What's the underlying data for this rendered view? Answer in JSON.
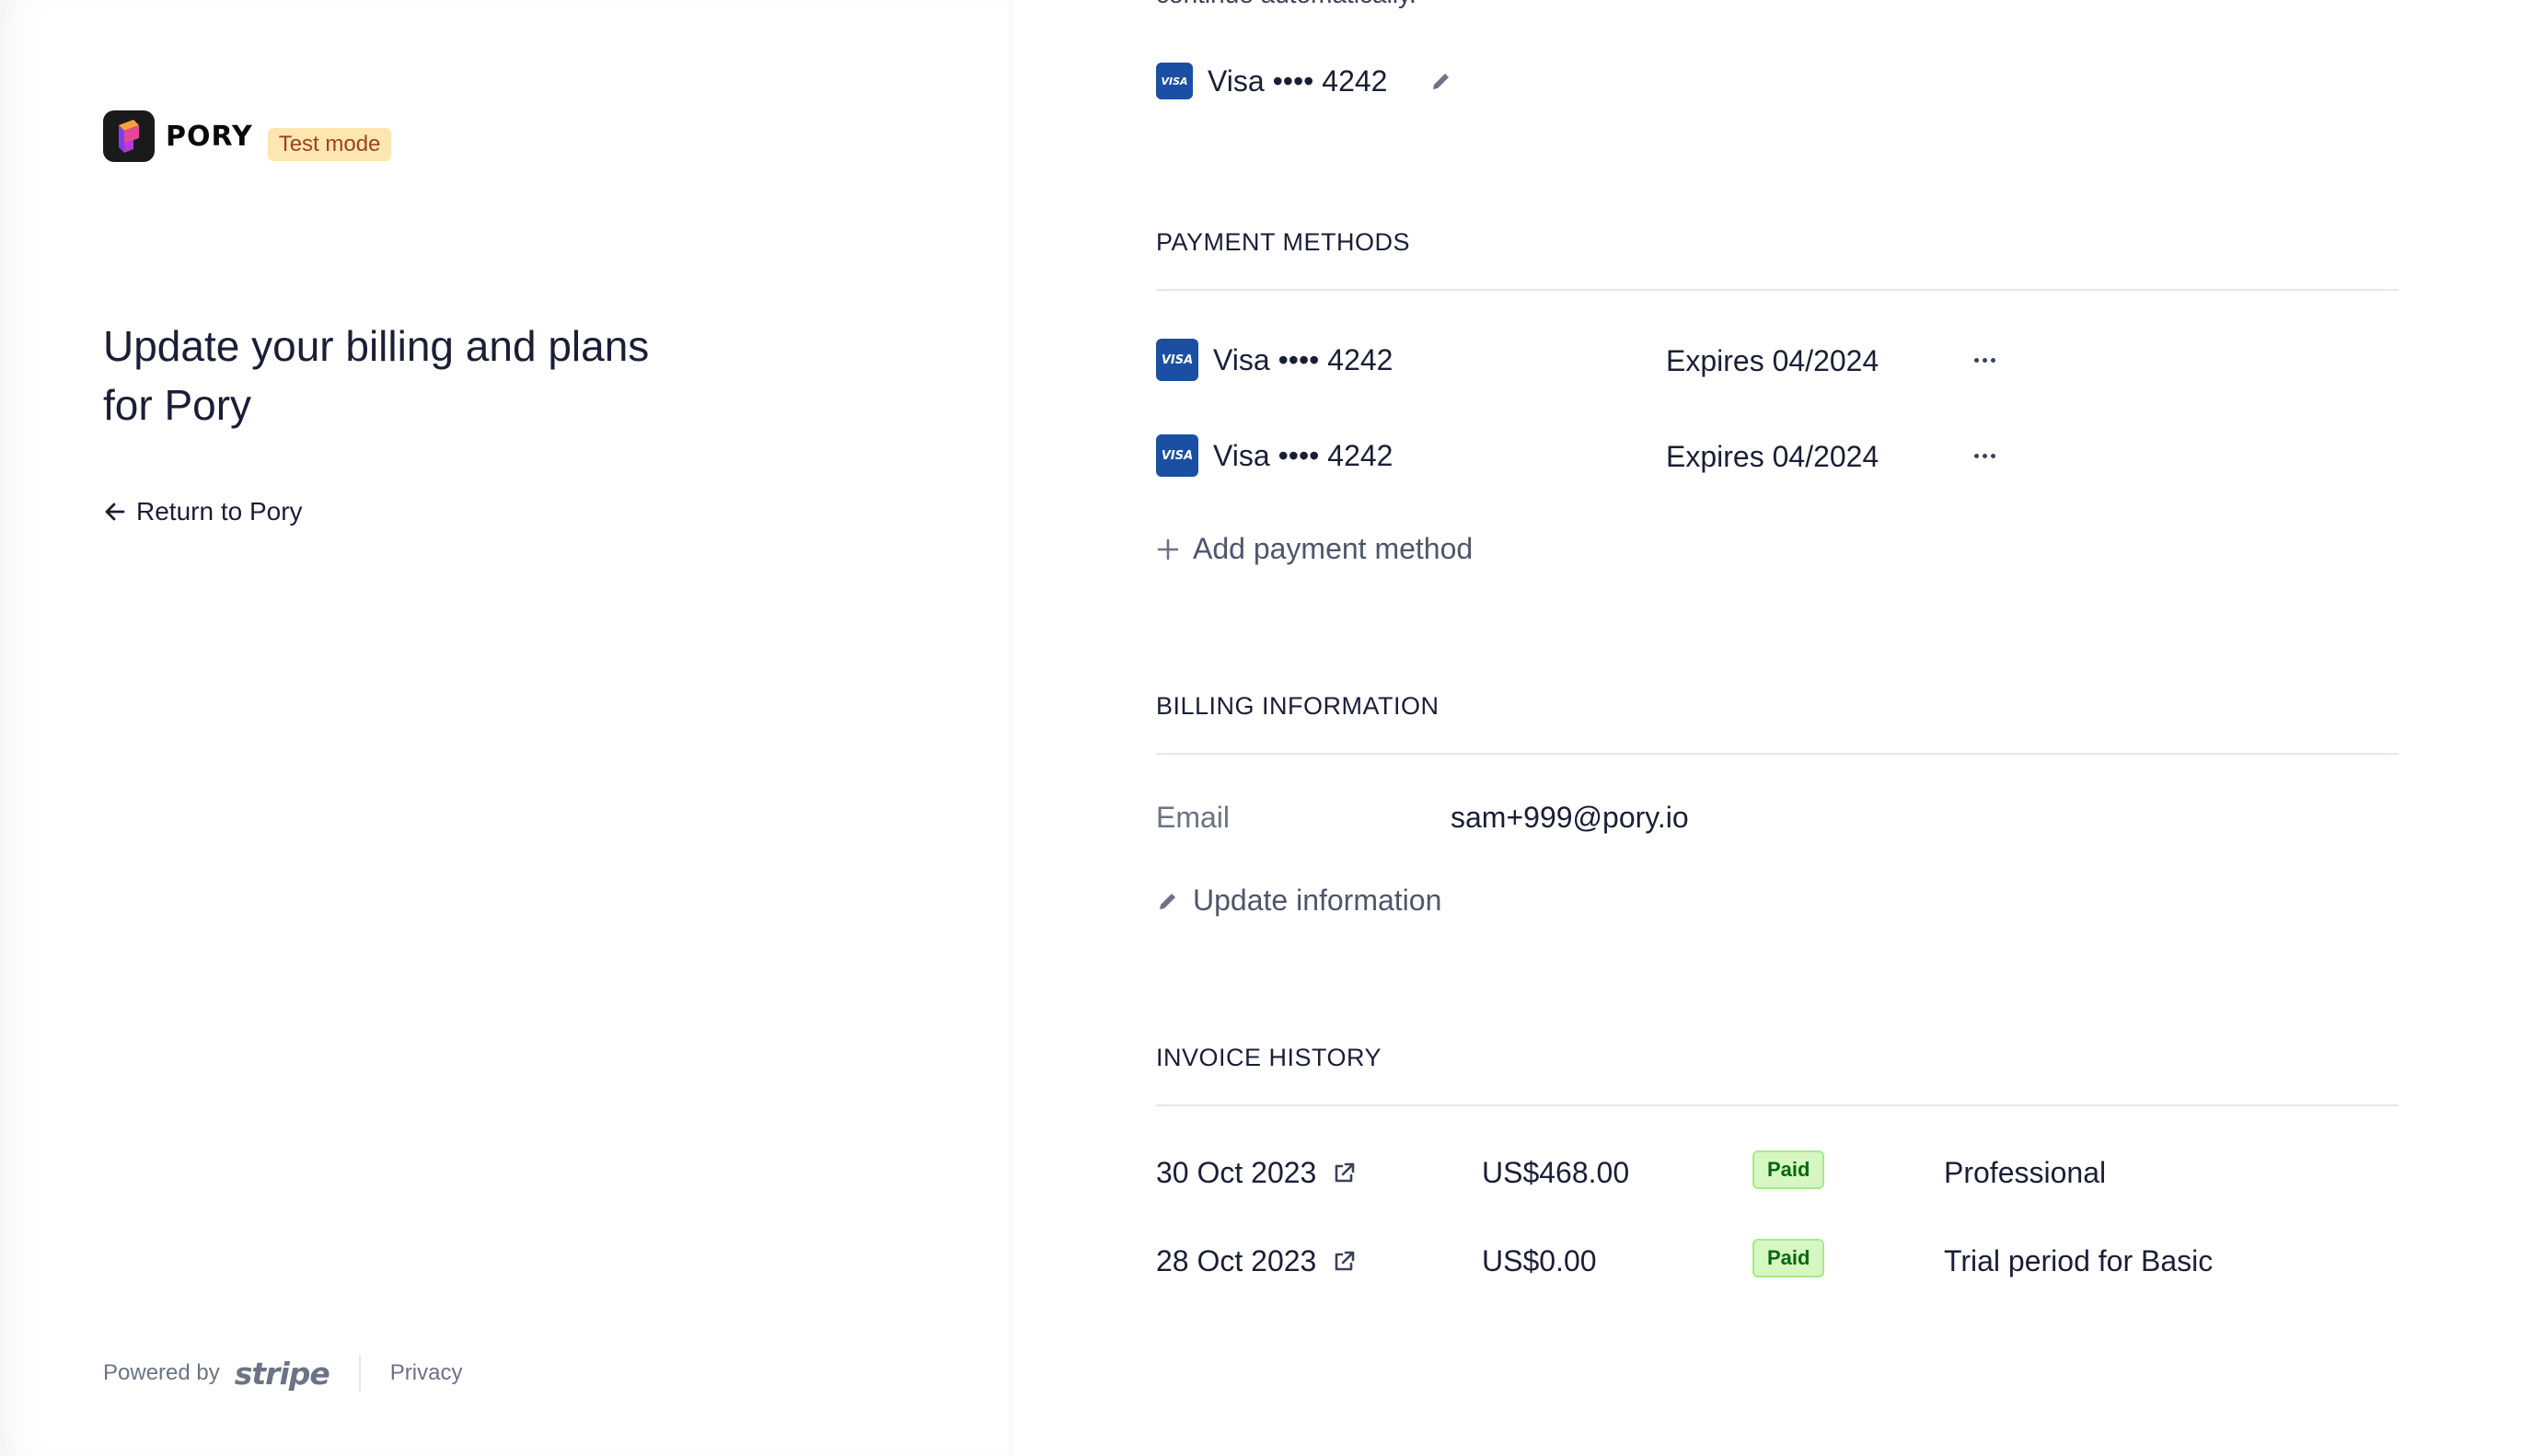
{
  "brand": {
    "name": "PORY",
    "badge": "Test mode"
  },
  "page_title": "Update your billing and plans for Pory",
  "return_link": "Return to Pory",
  "footer": {
    "powered_by": "Powered by",
    "provider": "stripe",
    "privacy": "Privacy"
  },
  "subscription": {
    "cut_text": "continue automatically.",
    "card": {
      "brand": "VISA",
      "label": "Visa •••• 4242"
    }
  },
  "payment_methods": {
    "title": "PAYMENT METHODS",
    "items": [
      {
        "brand": "VISA",
        "label": "Visa •••• 4242",
        "expires": "Expires 04/2024"
      },
      {
        "brand": "VISA",
        "label": "Visa •••• 4242",
        "expires": "Expires 04/2024"
      }
    ],
    "add_label": "Add payment method"
  },
  "billing_information": {
    "title": "BILLING INFORMATION",
    "email_label": "Email",
    "email_value": "sam+999@pory.io",
    "update_label": "Update information"
  },
  "invoice_history": {
    "title": "INVOICE HISTORY",
    "rows": [
      {
        "date": "30 Oct 2023",
        "amount": "US$468.00",
        "status": "Paid",
        "description": "Professional"
      },
      {
        "date": "28 Oct 2023",
        "amount": "US$0.00",
        "status": "Paid",
        "description": "Trial period for Basic"
      }
    ]
  },
  "colors": {
    "visa_blue": "#1a4fa3",
    "paid_bg": "#d7f7c2",
    "paid_text": "#05690d",
    "test_badge_bg": "#fde6b1"
  }
}
